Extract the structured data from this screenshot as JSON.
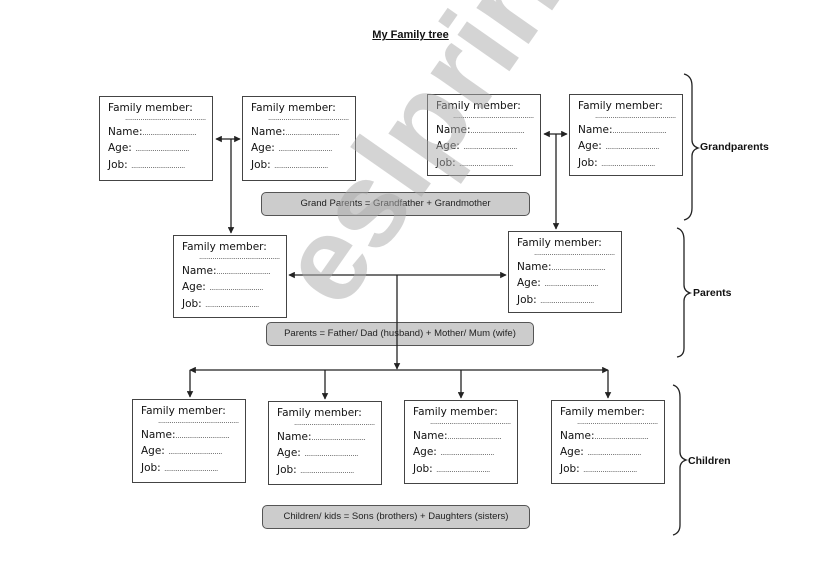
{
  "title": "My Family tree",
  "card": {
    "heading": "Family member:",
    "blank_line": "..........................................",
    "name_label": "Name:",
    "age_label": "Age:",
    "job_label": "Job:",
    "short_blank": "............................"
  },
  "generations": {
    "grandparents": {
      "label": "Grandparents",
      "definition": "Grand Parents = Grandfather + Grandmother",
      "member_count": 4
    },
    "parents": {
      "label": "Parents",
      "definition": "Parents = Father/ Dad (husband) + Mother/ Mum (wife)",
      "member_count": 2
    },
    "children": {
      "label": "Children",
      "definition": "Children/ kids = Sons (brothers) + Daughters (sisters)",
      "member_count": 4
    }
  },
  "watermark": "eslprintables.com",
  "colors": {
    "definition_fill": "#cccccc",
    "line": "#222222",
    "watermark": "#aaaaaa"
  }
}
